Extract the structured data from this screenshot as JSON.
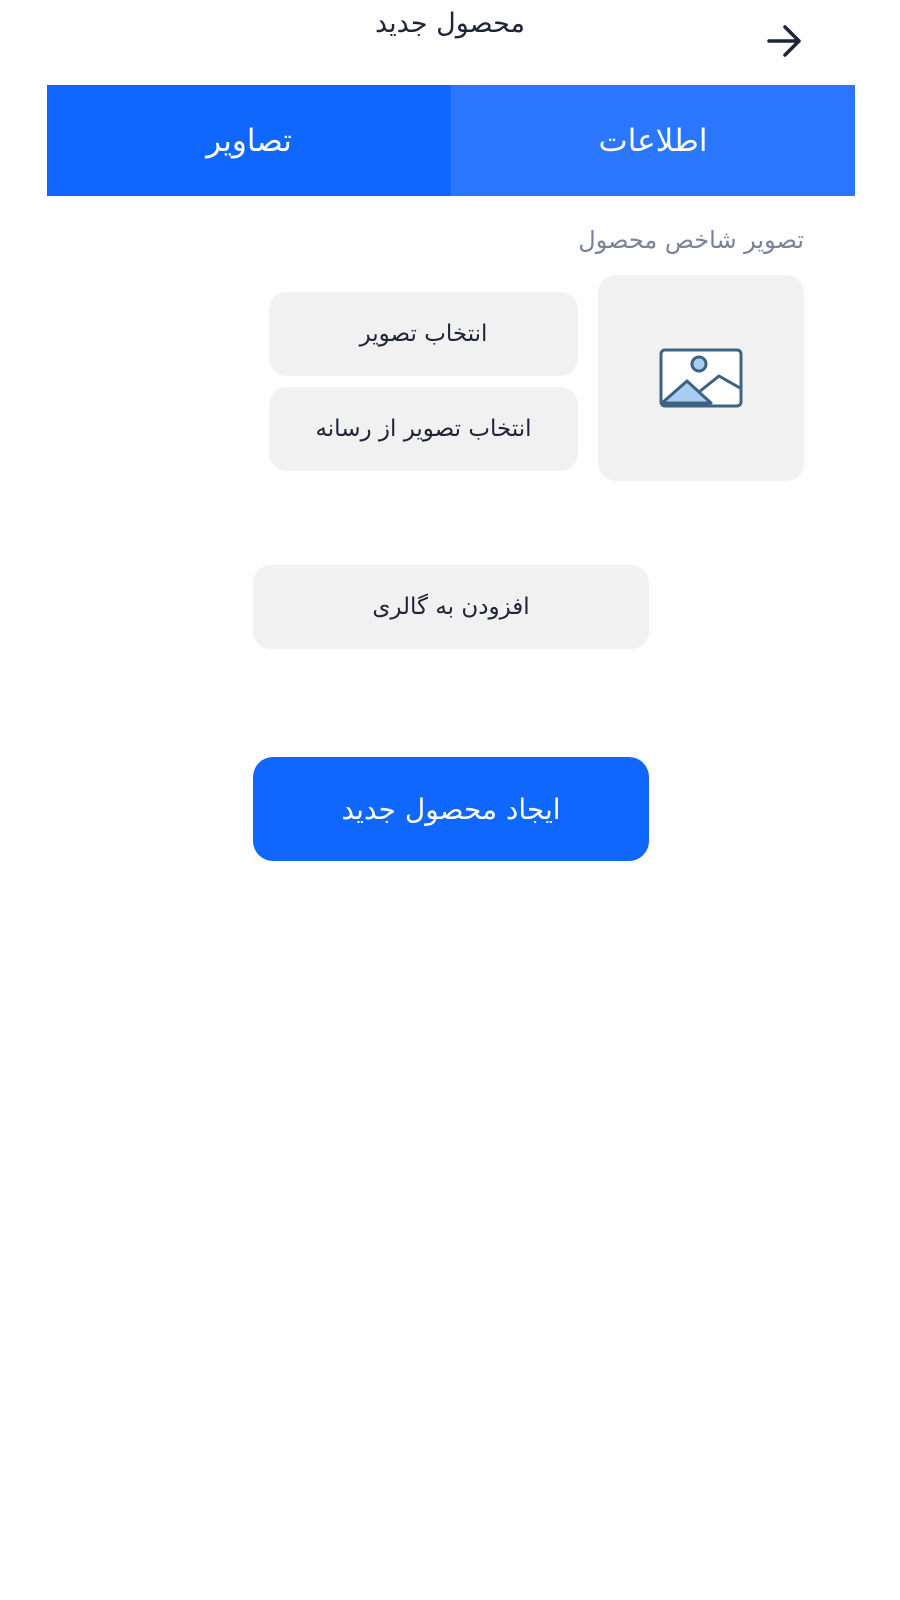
{
  "header": {
    "title": "محصول جدید",
    "back_icon": "arrow-right-icon"
  },
  "tabs": [
    {
      "label": "اطلاعات",
      "active": false
    },
    {
      "label": "تصاویر",
      "active": true
    }
  ],
  "featured_image": {
    "label": "تصویر شاخص محصول",
    "placeholder_icon": "image-placeholder-icon",
    "select_label": "انتخاب تصویر",
    "select_media_label": "انتخاب تصویر از رسانه"
  },
  "gallery": {
    "add_label": "افزودن به گالری"
  },
  "actions": {
    "create_label": "ایجاد محصول جدید"
  },
  "colors": {
    "accent": "#0f67fe",
    "tab_inactive": "#2a77fe",
    "button_gray": "#f1f1f1",
    "muted_text": "#7b8298"
  }
}
